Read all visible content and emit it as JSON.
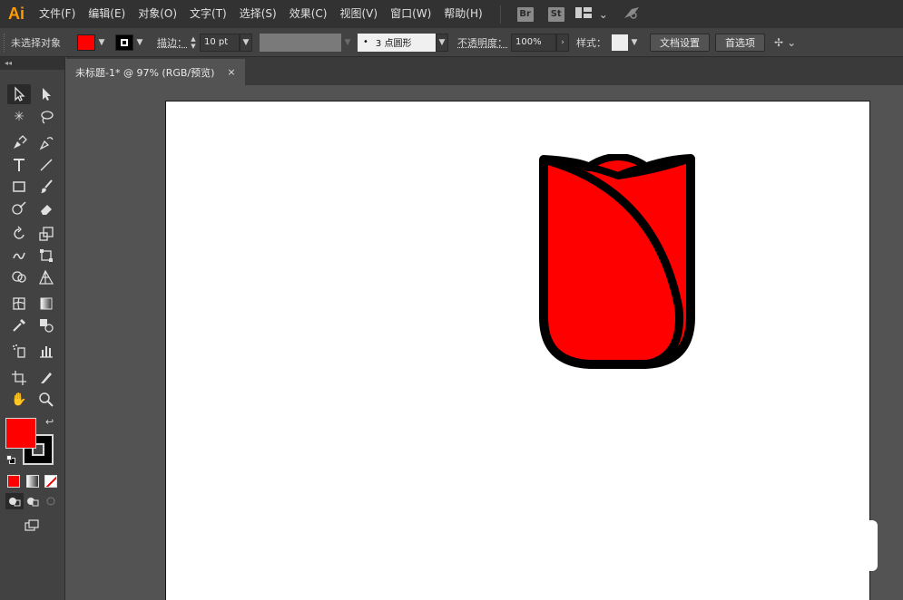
{
  "app": {
    "logo": "Ai"
  },
  "menubar": {
    "items": [
      "文件(F)",
      "编辑(E)",
      "对象(O)",
      "文字(T)",
      "选择(S)",
      "效果(C)",
      "视图(V)",
      "窗口(W)",
      "帮助(H)"
    ],
    "bridge_label": "Br",
    "stock_label": "St"
  },
  "controlbar": {
    "selection_status": "未选择对象",
    "fill_color": "#ff0000",
    "stroke_color": "#000000",
    "stroke_label": "描边：",
    "stroke_weight": "10 pt",
    "brush_label": "3 点圆形",
    "opacity_label": "不透明度：",
    "opacity_value": "100%",
    "style_label": "样式：",
    "doc_setup_button": "文档设置",
    "preferences_button": "首选项"
  },
  "toolpanel": {
    "collapse_label": "◂◂",
    "fill_color": "#ff0000",
    "stroke_color": "#000000"
  },
  "document": {
    "tab_title": "未标题-1* @ 97% (RGB/预览)",
    "close_label": "×"
  },
  "artwork": {
    "shape": "tulip",
    "fill": "#ff0000",
    "stroke": "#000000"
  }
}
